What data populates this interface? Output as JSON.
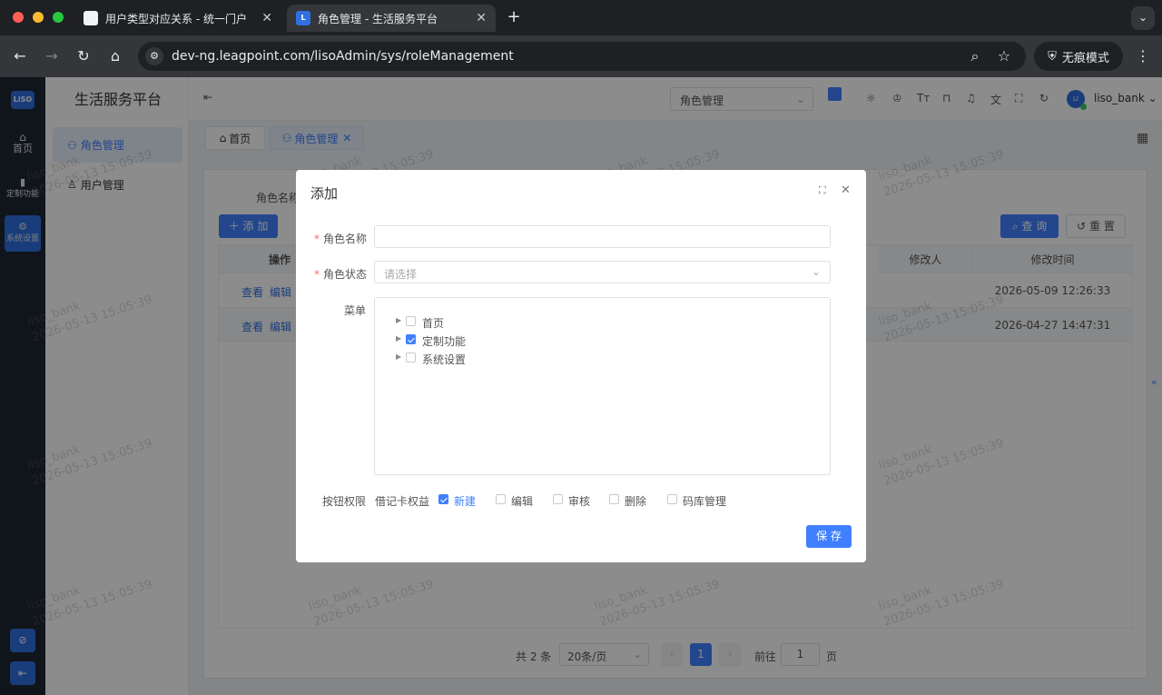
{
  "browser": {
    "tabs": [
      {
        "title": "用户类型对应关系 - 统一门户"
      },
      {
        "title": "角色管理 - 生活服务平台"
      }
    ],
    "new_tab": "+",
    "url": "dev-ng.leagpoint.com/lisoAdmin/sys/roleManagement",
    "incognito": "无痕模式"
  },
  "app": {
    "title": "生活服务平台",
    "logo_text": "LiSO",
    "rail": [
      {
        "label": "首页",
        "icon": "home-icon"
      },
      {
        "label": "定制功能",
        "icon": "puzzle-icon"
      },
      {
        "label": "系统设置",
        "icon": "gear-icon"
      }
    ],
    "subnav": [
      {
        "label": "角色管理",
        "active": true
      },
      {
        "label": "用户管理",
        "active": false
      }
    ],
    "header": {
      "select_value": "角色管理",
      "user": "liso_bank"
    },
    "tabs": [
      {
        "label": "首页"
      },
      {
        "label": "角色管理"
      }
    ],
    "search": {
      "label": "角色名称",
      "add": "添 加",
      "query": "查 询",
      "reset": "重 置"
    },
    "table": {
      "headers": {
        "op": "操作",
        "modifier": "修改人",
        "time": "修改时间"
      },
      "rows": [
        {
          "view": "查看",
          "edit": "编辑",
          "modifier": "",
          "time": "2026-05-09 12:26:33"
        },
        {
          "view": "查看",
          "edit": "编辑",
          "modifier": "",
          "time": "2026-04-27 14:47:31"
        }
      ]
    },
    "pagination": {
      "total": "共 2 条",
      "page_size": "20条/页",
      "current": "1",
      "goto_label": "前往",
      "goto_value": "1",
      "page_suffix": "页"
    }
  },
  "dialog": {
    "title": "添加",
    "fields": {
      "name_label": "角色名称",
      "name_value": "",
      "status_label": "角色状态",
      "status_placeholder": "请选择",
      "menu_label": "菜单"
    },
    "menu_tree": [
      {
        "label": "首页",
        "checked": false
      },
      {
        "label": "定制功能",
        "checked": true
      },
      {
        "label": "系统设置",
        "checked": false
      }
    ],
    "button_perm": {
      "label": "按钮权限",
      "group": "借记卡权益",
      "options": [
        {
          "label": "新建",
          "checked": true
        },
        {
          "label": "编辑",
          "checked": false
        },
        {
          "label": "审核",
          "checked": false
        },
        {
          "label": "删除",
          "checked": false
        },
        {
          "label": "码库管理",
          "checked": false
        }
      ]
    },
    "save": "保 存"
  },
  "watermark": {
    "user": "liso_bank",
    "time": "2026-05-13 15:05:39"
  },
  "colors": {
    "primary": "#4080ff",
    "rail": "#1e2632",
    "required": "#f56c6c"
  }
}
